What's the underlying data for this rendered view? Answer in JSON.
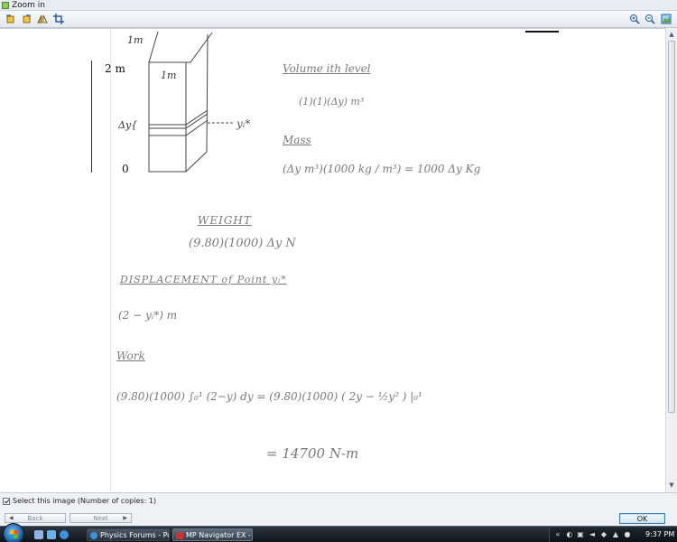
{
  "window": {
    "title": "Zoom in"
  },
  "toolbar": {
    "left_icons": [
      "rotate-left-icon",
      "rotate-right-icon",
      "flip-icon",
      "crop-icon"
    ],
    "right_icons": [
      "zoom-in-icon",
      "zoom-out-icon",
      "fit-image-icon"
    ]
  },
  "image": {
    "scale_top_label": "2 m",
    "scale_bottom_label": "0",
    "sketch": {
      "top_dim": "1m",
      "front_dim": "1m",
      "slice_label": "Δy{",
      "marker": "yᵢ*"
    },
    "notes": {
      "volume_heading": "Volume ith level",
      "volume_expr": "(1)(1)(Δy)  m³",
      "mass_heading": "Mass",
      "mass_expr": "(Δy m³)(1000 kg / m³) = 1000 Δy  Kg",
      "weight_heading": "WEIGHT",
      "weight_expr": "(9.80)(1000) Δy    N",
      "displacement_heading": "DISPLACEMENT  of Point  yᵢ*",
      "displacement_expr": "(2 − yᵢ*) m",
      "work_heading": "Work",
      "work_expr": "(9.80)(1000) ∫₀¹ (2−y) dy  =  (9.80)(1000) ( 2y − ½y² ) |₀¹",
      "result": "= 14700  N-m"
    }
  },
  "footer": {
    "select_label": "Select this image (Number of copies: 1)",
    "select_checked": true,
    "back_label": "Back",
    "next_label": "Next",
    "ok_label": "OK"
  },
  "taskbar": {
    "tasks": [
      {
        "label": "Physics Forums - Po...",
        "active": false
      },
      {
        "label": "MP Navigator EX - ...",
        "active": true
      }
    ],
    "clock": "9:37 PM"
  },
  "colors": {
    "ink": "#7a7a7a",
    "paper": "#ffffff",
    "accent": "#3c7fb1"
  }
}
